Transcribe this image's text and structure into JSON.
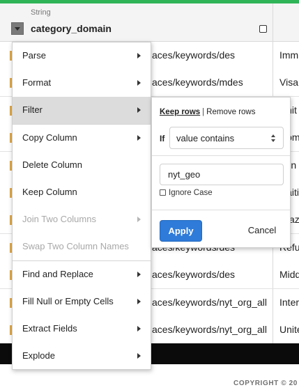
{
  "column": {
    "type": "String",
    "name": "category_domain"
  },
  "rows": [
    {
      "a": "aces/keywords/des",
      "b": "Imm"
    },
    {
      "a": "aces/keywords/mdes",
      "b": "Visa"
    },
    {
      "a": "",
      "b": "Unit"
    },
    {
      "a": "",
      "b": "Dom"
    },
    {
      "a": "",
      "b": "Fun"
    },
    {
      "a": "",
      "b": "Haiti"
    },
    {
      "a": "",
      "b": "Braz"
    },
    {
      "a": "aces/keywords/des",
      "b": "Refu"
    },
    {
      "a": "aces/keywords/des",
      "b": "Midd"
    },
    {
      "a": "aces/keywords/nyt_org_all",
      "b": "Inter"
    },
    {
      "a": "aces/keywords/nyt_org_all",
      "b": "Unite"
    }
  ],
  "menu": {
    "items": [
      {
        "label": "Parse",
        "submenu": true,
        "disabled": false
      },
      {
        "label": "Format",
        "submenu": true,
        "disabled": false
      },
      {
        "label": "Filter",
        "submenu": true,
        "disabled": false,
        "active": true
      },
      {
        "label": "Copy Column",
        "submenu": true,
        "disabled": false
      },
      {
        "label": "Delete Column",
        "submenu": false,
        "disabled": false
      },
      {
        "label": "Keep Column",
        "submenu": false,
        "disabled": false
      },
      {
        "label": "Join Two Columns",
        "submenu": true,
        "disabled": true
      },
      {
        "label": "Swap Two Column Names",
        "submenu": false,
        "disabled": true
      },
      {
        "label": "Find and Replace",
        "submenu": true,
        "disabled": false
      },
      {
        "label": "Fill Null or Empty Cells",
        "submenu": true,
        "disabled": false
      },
      {
        "label": "Extract Fields",
        "submenu": true,
        "disabled": false
      },
      {
        "label": "Explode",
        "submenu": true,
        "disabled": false
      }
    ]
  },
  "filter": {
    "keep_rows": "Keep rows",
    "separator": "|",
    "remove_rows": "Remove rows",
    "if_label": "If",
    "condition": "value contains",
    "value": "nyt_geo",
    "ignore_case": "Ignore Case",
    "apply": "Apply",
    "cancel": "Cancel"
  },
  "footer": {
    "copyright": "COPYRIGHT © 20"
  },
  "colors": {
    "accent_green": "#2fb457",
    "apply_blue": "#2e7bd9"
  }
}
